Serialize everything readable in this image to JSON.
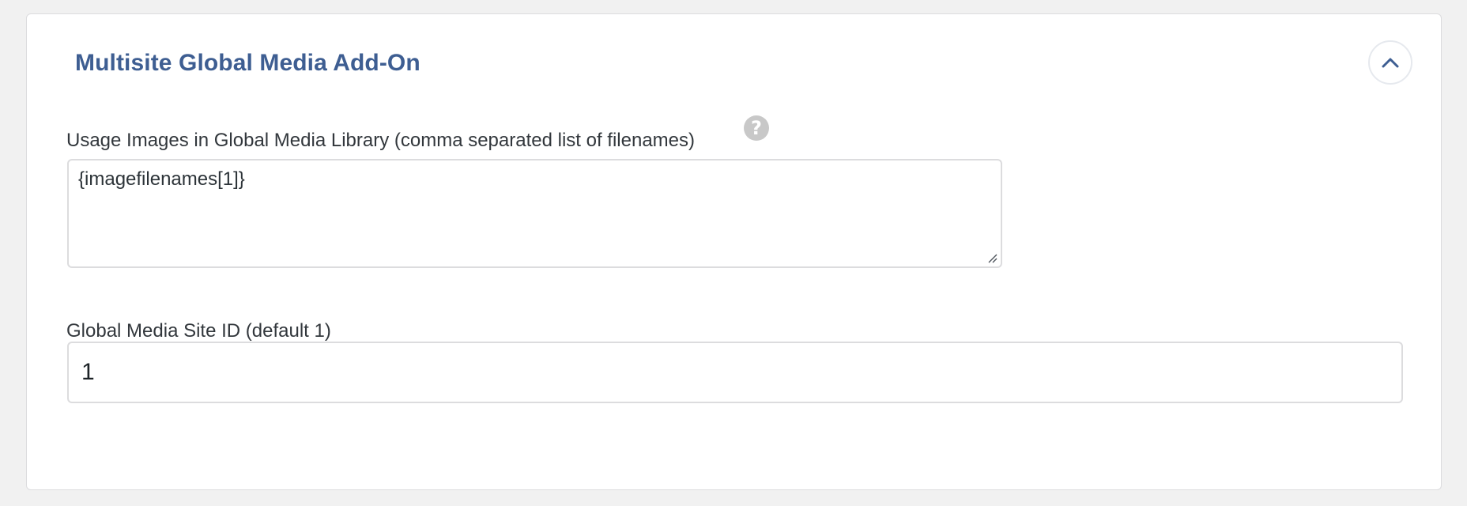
{
  "panel": {
    "title": "Multisite Global Media Add-On"
  },
  "usage_images": {
    "label": "Usage Images in Global Media Library (comma separated list of filenames)",
    "help_glyph": "?",
    "value": "{imagefilenames[1]}"
  },
  "site_id": {
    "label": "Global Media Site ID (default 1)",
    "value": "1"
  },
  "colors": {
    "title": "#3e5e92",
    "background": "#f1f1f1",
    "panel": "#ffffff",
    "border": "#dcdcde",
    "help_icon": "#c8c8c8"
  },
  "icons": {
    "collapse": "chevron-up-icon",
    "help": "question-circle-icon",
    "resize": "resize-handle-icon"
  }
}
